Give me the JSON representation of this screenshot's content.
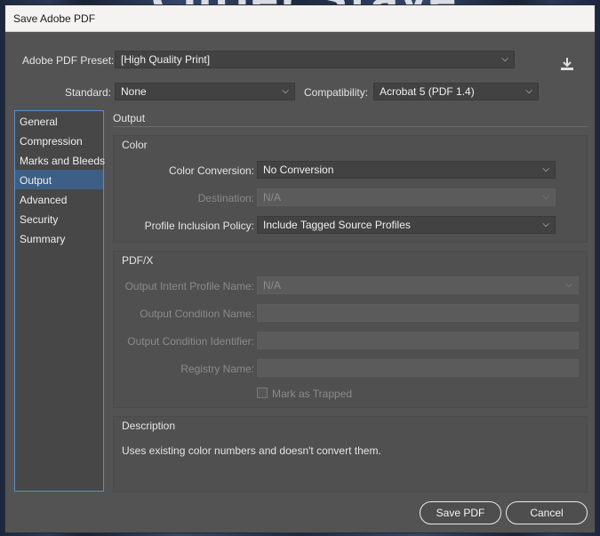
{
  "background": {
    "art_text": "Cutler Stave"
  },
  "window": {
    "title": "Save Adobe PDF"
  },
  "top": {
    "preset_label": "Adobe PDF Preset:",
    "preset_value": "[High Quality Print]",
    "standard_label": "Standard:",
    "standard_value": "None",
    "compatibility_label": "Compatibility:",
    "compatibility_value": "Acrobat 5 (PDF 1.4)"
  },
  "sidebar": {
    "items": [
      {
        "label": "General"
      },
      {
        "label": "Compression"
      },
      {
        "label": "Marks and Bleeds"
      },
      {
        "label": "Output",
        "active": true
      },
      {
        "label": "Advanced"
      },
      {
        "label": "Security"
      },
      {
        "label": "Summary"
      }
    ]
  },
  "output": {
    "section_title": "Output",
    "color": {
      "group_title": "Color",
      "conversion_label": "Color Conversion:",
      "conversion_value": "No Conversion",
      "destination_label": "Destination:",
      "destination_value": "N/A",
      "profile_label": "Profile Inclusion Policy:",
      "profile_value": "Include Tagged Source Profiles"
    },
    "pdfx": {
      "group_title": "PDF/X",
      "intent_label": "Output Intent Profile Name:",
      "intent_value": "N/A",
      "condition_name_label": "Output Condition Name:",
      "condition_id_label": "Output Condition Identifier:",
      "registry_label": "Registry Name:",
      "trapped_label": "Mark as Trapped"
    },
    "description": {
      "group_title": "Description",
      "text": "Uses existing color numbers and doesn't convert them."
    }
  },
  "buttons": {
    "save": "Save PDF",
    "cancel": "Cancel"
  },
  "icons": {
    "save_preset": "download-icon",
    "dropdown": "chevron-down-icon"
  },
  "colors": {
    "dialog_bg": "#535353",
    "accent": "#3d5f85",
    "sidebar_border": "#5a8ec6"
  }
}
